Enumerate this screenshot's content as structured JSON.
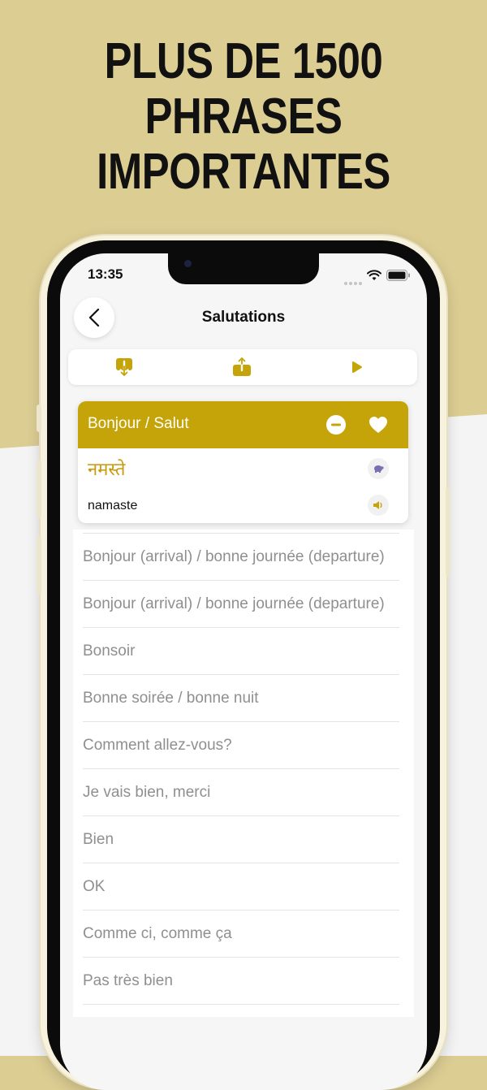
{
  "headline": {
    "line1": "PLUS DE 1500",
    "line2": "PHRASES",
    "line3": "IMPORTANTES"
  },
  "status_bar": {
    "time": "13:35"
  },
  "nav": {
    "title": "Salutations"
  },
  "toolbar": {
    "icons": [
      "download-icon",
      "share-icon",
      "play-icon"
    ]
  },
  "colors": {
    "accent": "#c4a408",
    "native_text": "#c99a0a",
    "background_top": "#dccd92"
  },
  "card": {
    "phrase": "Bonjour / Salut",
    "native": "नमस्ते",
    "romanization": "namaste"
  },
  "phrases": [
    "Bonjour (arrival) / bonne journée (departure)",
    "Bonjour (arrival) / bonne journée (departure)",
    "Bonsoir",
    "Bonne soirée / bonne nuit",
    "Comment allez-vous?",
    "Je vais bien, merci",
    "Bien",
    "OK",
    "Comme ci, comme ça",
    "Pas très bien"
  ]
}
